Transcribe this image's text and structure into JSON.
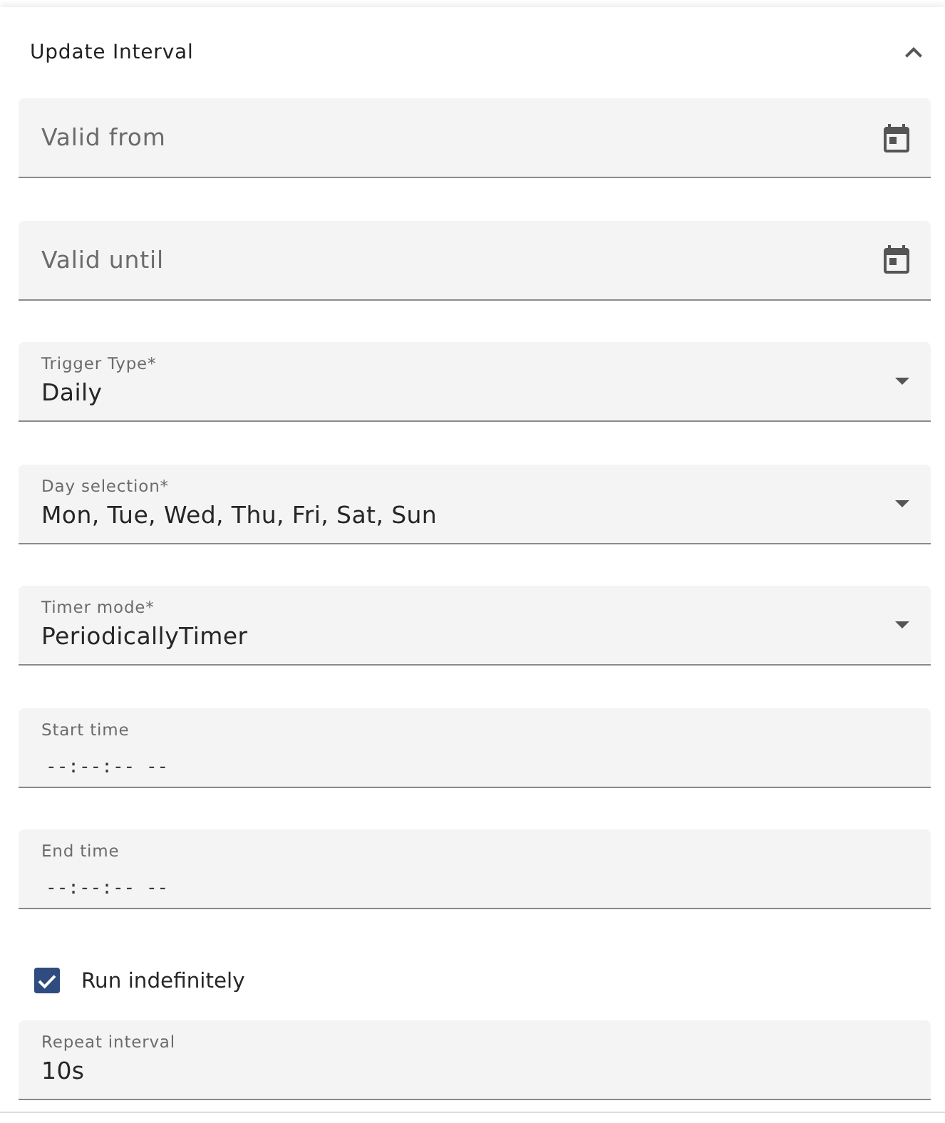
{
  "section": {
    "title": "Update Interval",
    "expanded": true
  },
  "fields": [
    {
      "kind": "date",
      "label": "Valid from"
    },
    {
      "kind": "date",
      "label": "Valid until"
    },
    {
      "kind": "select",
      "label": "Trigger Type*",
      "value": "Daily"
    },
    {
      "kind": "select",
      "label": "Day selection*",
      "value": "Mon, Tue, Wed, Thu, Fri, Sat, Sun"
    },
    {
      "kind": "select",
      "label": "Timer mode*",
      "value": "PeriodicallyTimer"
    },
    {
      "kind": "time",
      "label": "Start time",
      "placeholder": "--:--:-- --"
    },
    {
      "kind": "time",
      "label": "End time",
      "placeholder": "--:--:-- --"
    },
    {
      "kind": "checkbox",
      "label": "Run indefinitely",
      "checked": true
    },
    {
      "kind": "text",
      "label": "Repeat interval",
      "value": "10s"
    }
  ]
}
